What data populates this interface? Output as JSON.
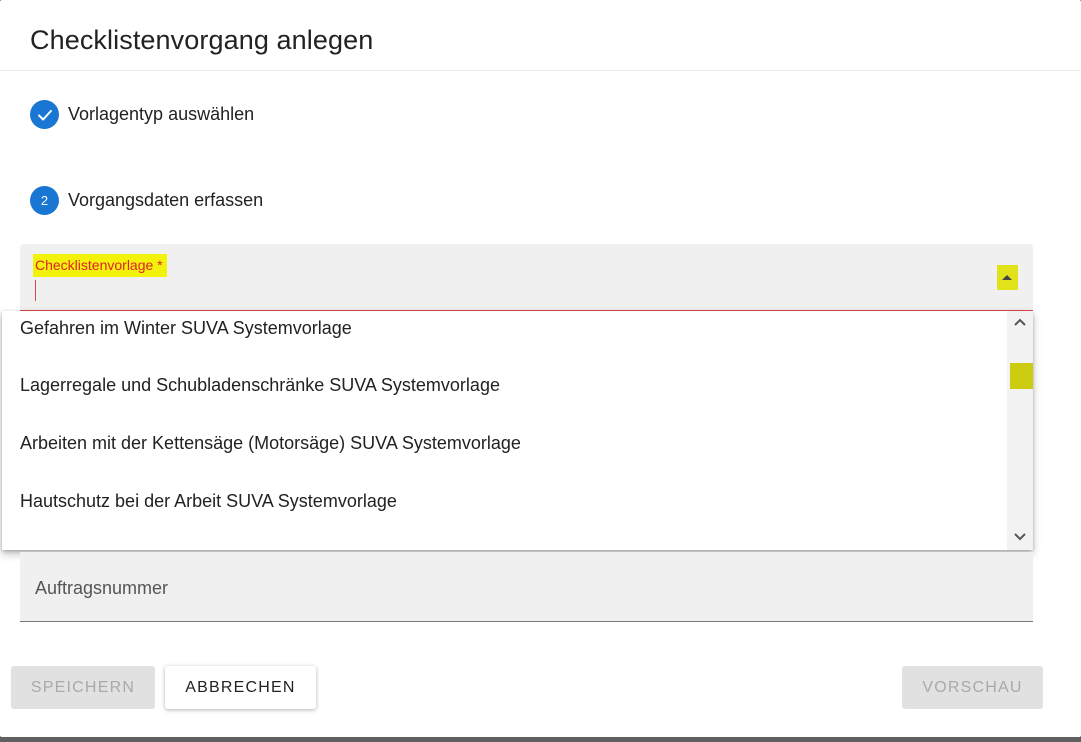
{
  "dialog": {
    "title": "Checklistenvorgang anlegen"
  },
  "steps": [
    {
      "number": "✓",
      "label": "Vorlagentyp auswählen",
      "state": "completed"
    },
    {
      "number": "2",
      "label": "Vorgangsdaten erfassen",
      "state": "active"
    }
  ],
  "template_field": {
    "label": "Checklistenvorlage *",
    "value": "",
    "arrow_icon": "arrow-up-icon"
  },
  "dropdown": {
    "options": [
      "Gefahren im Winter SUVA Systemvorlage",
      "Lagerregale und Schubladenschränke SUVA Systemvorlage",
      "Arbeiten mit der Kettensäge (Motorsäge) SUVA Systemvorlage",
      "Hautschutz bei der Arbeit SUVA Systemvorlage"
    ],
    "scroll_up_icon": "chevron-up-icon",
    "scroll_down_icon": "chevron-down-icon"
  },
  "order_field": {
    "placeholder": "Auftragsnummer"
  },
  "actions": {
    "save_label": "SPEICHERN",
    "cancel_label": "ABBRECHEN",
    "preview_label": "VORSCHAU"
  },
  "colors": {
    "primary": "#1976d2",
    "highlight": "#f2f20a",
    "error": "#e1222b"
  }
}
